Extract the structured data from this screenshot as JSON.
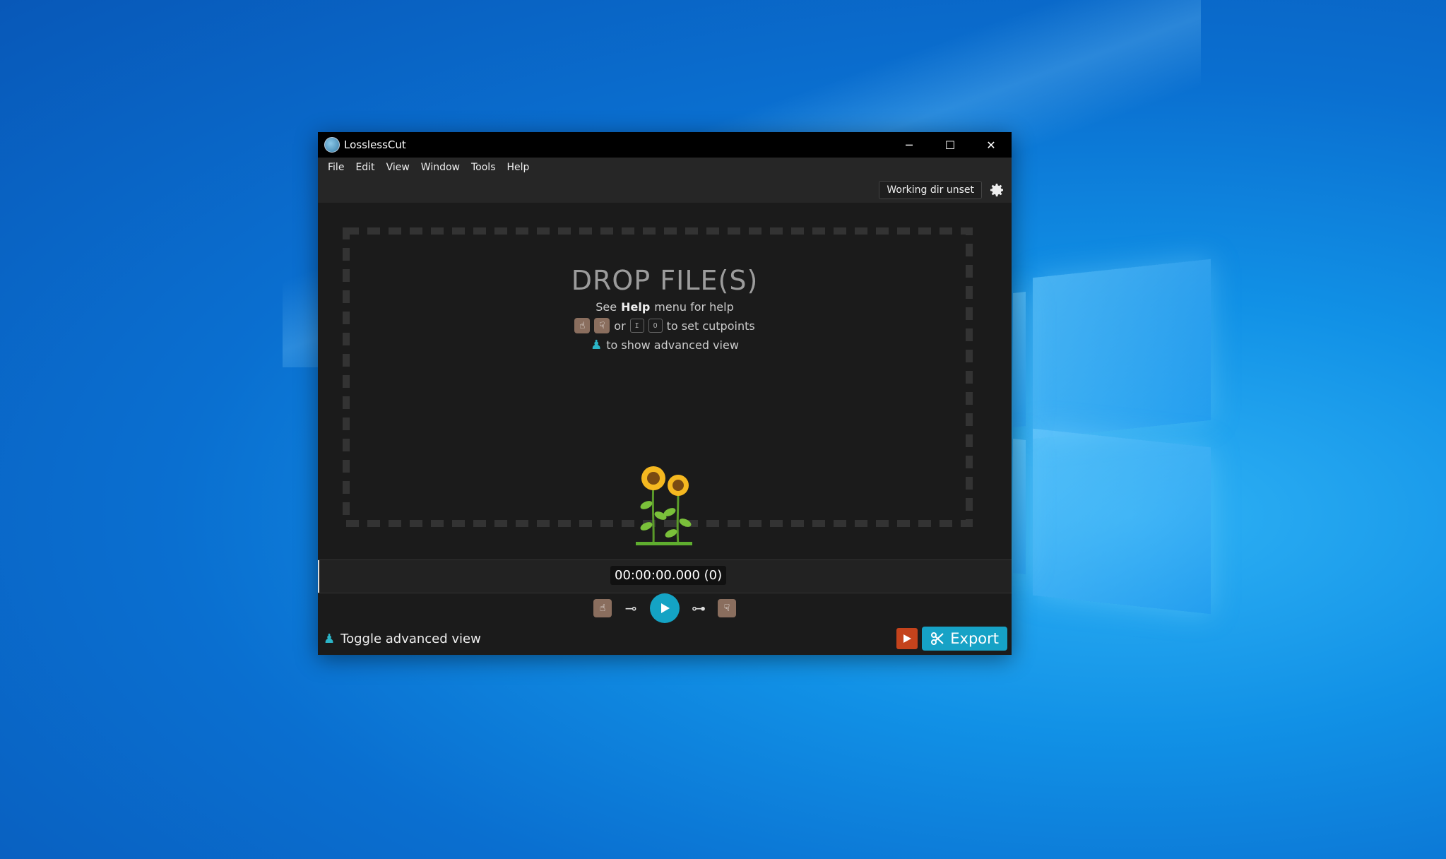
{
  "window": {
    "title": "LosslessCut",
    "minimize_glyph": "─",
    "maximize_glyph": "☐",
    "close_glyph": "✕"
  },
  "menu": [
    "File",
    "Edit",
    "View",
    "Window",
    "Tools",
    "Help"
  ],
  "topbar": {
    "working_dir": "Working dir unset",
    "settings_icon": "gear-icon"
  },
  "drop": {
    "title": "DROP FILE(S)",
    "help_prefix": "See",
    "help_bold": "Help",
    "help_suffix": "menu for help",
    "cut_or": "or",
    "cut_key_in": "I",
    "cut_key_out": "O",
    "cut_suffix": "to set cutpoints",
    "advanced_text": "to show advanced view"
  },
  "timeline": {
    "time": "00:00:00.000 (0)"
  },
  "bottom": {
    "toggle_label": "Toggle advanced view",
    "export_label": "Export"
  },
  "colors": {
    "accent": "#16a2c6",
    "preview": "#c4431c",
    "hand": "#8a6e5e"
  }
}
